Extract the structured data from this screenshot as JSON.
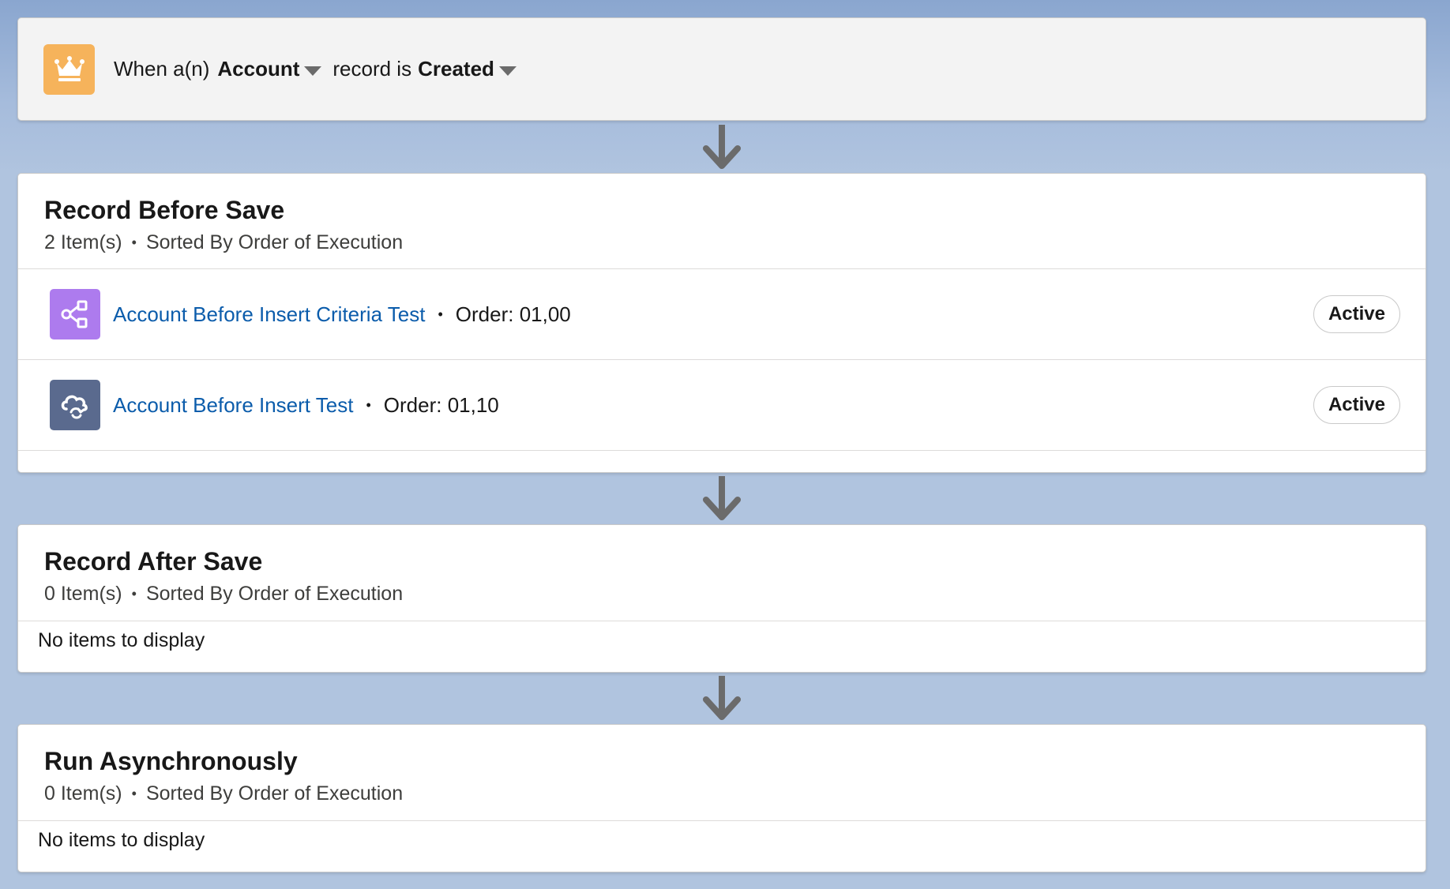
{
  "trigger": {
    "prefix": "When a(n)",
    "object": "Account",
    "middle": "record is",
    "event": "Created",
    "icon": "crown-icon",
    "icon_color": "#f6b35b"
  },
  "sections": [
    {
      "title": "Record Before Save",
      "count": "2 Item(s)",
      "sort": "Sorted By Order of Execution",
      "items": [
        {
          "name": "Account Before Insert Criteria Test",
          "order": "Order: 01,00",
          "status": "Active",
          "icon": "flow-icon",
          "icon_color": "#ad7bee"
        },
        {
          "name": "Account Before Insert Test",
          "order": "Order: 01,10",
          "status": "Active",
          "icon": "cloud-refresh-icon",
          "icon_color": "#5a6a8e"
        }
      ]
    },
    {
      "title": "Record After Save",
      "count": "0 Item(s)",
      "sort": "Sorted By Order of Execution",
      "empty": "No items to display"
    },
    {
      "title": "Run Asynchronously",
      "count": "0 Item(s)",
      "sort": "Sorted By Order of Execution",
      "empty": "No items to display"
    }
  ],
  "separator": "•"
}
